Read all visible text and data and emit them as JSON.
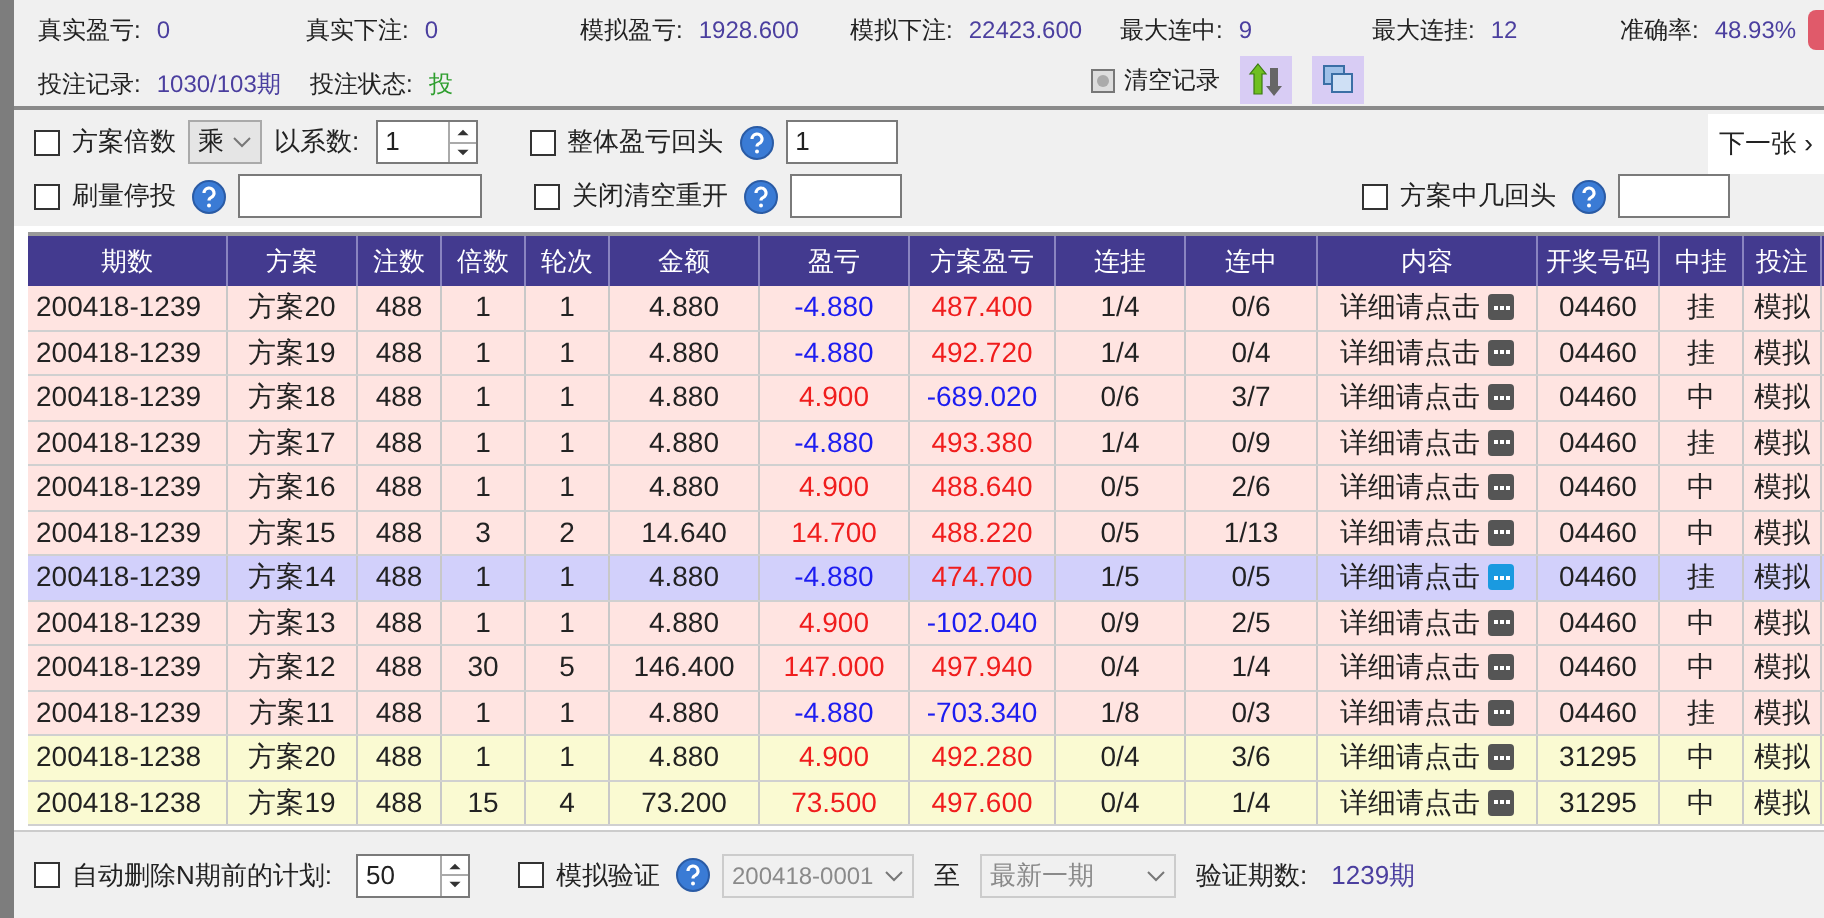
{
  "stats_row_1": [
    {
      "label": "真实盈亏:",
      "value": "0"
    },
    {
      "label": "真实下注:",
      "value": "0"
    },
    {
      "label": "模拟盈亏:",
      "value": "1928.600"
    },
    {
      "label": "模拟下注:",
      "value": "22423.600"
    },
    {
      "label": "最大连中:",
      "value": "9"
    },
    {
      "label": "最大连挂:",
      "value": "12"
    },
    {
      "label": "准确率:",
      "value": "48.93%"
    }
  ],
  "stats_row_2": [
    {
      "label": "投注记录:",
      "value": "1030/103期",
      "kind": "normal"
    },
    {
      "label": "投注状态:",
      "value": "投",
      "kind": "status"
    }
  ],
  "clear_button": "清空记录",
  "options": {
    "scheme_multiple": {
      "label": "方案倍数",
      "checked": false
    },
    "operator": "乘",
    "coefficient_label": "以系数:",
    "coefficient": "1",
    "overall_reset": {
      "label": "整体盈亏回头",
      "checked": false,
      "value": "1"
    },
    "volume_stop": {
      "label": "刷量停投",
      "checked": false
    },
    "close_clear": {
      "label": "关闭清空重开",
      "checked": false
    },
    "scheme_hit_reset": {
      "label": "方案中几回头",
      "checked": false
    },
    "next_button": "下一张 ›"
  },
  "table": {
    "columns": [
      "期数",
      "方案",
      "注数",
      "倍数",
      "轮次",
      "金额",
      "盈亏",
      "方案盈亏",
      "连挂",
      "连中",
      "内容",
      "开奖号码",
      "中挂",
      "投注"
    ],
    "rows": [
      {
        "selected": false,
        "color": "#ffe4e1",
        "period": "200418-1239",
        "scheme": "方案20",
        "count": "488",
        "multiple": "1",
        "round": "1",
        "amount": "4.880",
        "profit": "-4.880",
        "profit_negative": true,
        "scheme_profit": "487.400",
        "scheme_profit_negative": false,
        "miss_streak": "1/4",
        "hit_streak": "0/6",
        "content": "详细请点击",
        "draw": "04460",
        "result": "挂",
        "bet": "模拟"
      },
      {
        "selected": false,
        "color": "#ffe4e1",
        "period": "200418-1239",
        "scheme": "方案19",
        "count": "488",
        "multiple": "1",
        "round": "1",
        "amount": "4.880",
        "profit": "-4.880",
        "profit_negative": true,
        "scheme_profit": "492.720",
        "scheme_profit_negative": false,
        "miss_streak": "1/4",
        "hit_streak": "0/4",
        "content": "详细请点击",
        "draw": "04460",
        "result": "挂",
        "bet": "模拟"
      },
      {
        "selected": false,
        "color": "#ffe4e1",
        "period": "200418-1239",
        "scheme": "方案18",
        "count": "488",
        "multiple": "1",
        "round": "1",
        "amount": "4.880",
        "profit": "4.900",
        "profit_negative": false,
        "scheme_profit": "-689.020",
        "scheme_profit_negative": true,
        "miss_streak": "0/6",
        "hit_streak": "3/7",
        "content": "详细请点击",
        "draw": "04460",
        "result": "中",
        "bet": "模拟"
      },
      {
        "selected": false,
        "color": "#ffe4e1",
        "period": "200418-1239",
        "scheme": "方案17",
        "count": "488",
        "multiple": "1",
        "round": "1",
        "amount": "4.880",
        "profit": "-4.880",
        "profit_negative": true,
        "scheme_profit": "493.380",
        "scheme_profit_negative": false,
        "miss_streak": "1/4",
        "hit_streak": "0/9",
        "content": "详细请点击",
        "draw": "04460",
        "result": "挂",
        "bet": "模拟"
      },
      {
        "selected": false,
        "color": "#ffe4e1",
        "period": "200418-1239",
        "scheme": "方案16",
        "count": "488",
        "multiple": "1",
        "round": "1",
        "amount": "4.880",
        "profit": "4.900",
        "profit_negative": false,
        "scheme_profit": "488.640",
        "scheme_profit_negative": false,
        "miss_streak": "0/5",
        "hit_streak": "2/6",
        "content": "详细请点击",
        "draw": "04460",
        "result": "中",
        "bet": "模拟"
      },
      {
        "selected": false,
        "color": "#ffe4e1",
        "period": "200418-1239",
        "scheme": "方案15",
        "count": "488",
        "multiple": "3",
        "round": "2",
        "amount": "14.640",
        "profit": "14.700",
        "profit_negative": false,
        "scheme_profit": "488.220",
        "scheme_profit_negative": false,
        "miss_streak": "0/5",
        "hit_streak": "1/13",
        "content": "详细请点击",
        "draw": "04460",
        "result": "中",
        "bet": "模拟"
      },
      {
        "selected": true,
        "color": "#d2d0fb",
        "period": "200418-1239",
        "scheme": "方案14",
        "count": "488",
        "multiple": "1",
        "round": "1",
        "amount": "4.880",
        "profit": "-4.880",
        "profit_negative": true,
        "scheme_profit": "474.700",
        "scheme_profit_negative": false,
        "miss_streak": "1/5",
        "hit_streak": "0/5",
        "content": "详细请点击",
        "draw": "04460",
        "result": "挂",
        "bet": "模拟"
      },
      {
        "selected": false,
        "color": "#ffe4e1",
        "period": "200418-1239",
        "scheme": "方案13",
        "count": "488",
        "multiple": "1",
        "round": "1",
        "amount": "4.880",
        "profit": "4.900",
        "profit_negative": false,
        "scheme_profit": "-102.040",
        "scheme_profit_negative": true,
        "miss_streak": "0/9",
        "hit_streak": "2/5",
        "content": "详细请点击",
        "draw": "04460",
        "result": "中",
        "bet": "模拟"
      },
      {
        "selected": false,
        "color": "#ffe4e1",
        "period": "200418-1239",
        "scheme": "方案12",
        "count": "488",
        "multiple": "30",
        "round": "5",
        "amount": "146.400",
        "profit": "147.000",
        "profit_negative": false,
        "scheme_profit": "497.940",
        "scheme_profit_negative": false,
        "miss_streak": "0/4",
        "hit_streak": "1/4",
        "content": "详细请点击",
        "draw": "04460",
        "result": "中",
        "bet": "模拟"
      },
      {
        "selected": false,
        "color": "#ffe4e1",
        "period": "200418-1239",
        "scheme": "方案11",
        "count": "488",
        "multiple": "1",
        "round": "1",
        "amount": "4.880",
        "profit": "-4.880",
        "profit_negative": true,
        "scheme_profit": "-703.340",
        "scheme_profit_negative": true,
        "miss_streak": "1/8",
        "hit_streak": "0/3",
        "content": "详细请点击",
        "draw": "04460",
        "result": "挂",
        "bet": "模拟"
      },
      {
        "selected": false,
        "color": "#fafad2",
        "period": "200418-1238",
        "scheme": "方案20",
        "count": "488",
        "multiple": "1",
        "round": "1",
        "amount": "4.880",
        "profit": "4.900",
        "profit_negative": false,
        "scheme_profit": "492.280",
        "scheme_profit_negative": false,
        "miss_streak": "0/4",
        "hit_streak": "3/6",
        "content": "详细请点击",
        "draw": "31295",
        "result": "中",
        "bet": "模拟"
      },
      {
        "selected": false,
        "color": "#fafad2",
        "period": "200418-1238",
        "scheme": "方案19",
        "count": "488",
        "multiple": "15",
        "round": "4",
        "amount": "73.200",
        "profit": "73.500",
        "profit_negative": false,
        "scheme_profit": "497.600",
        "scheme_profit_negative": false,
        "miss_streak": "0/4",
        "hit_streak": "1/4",
        "content": "详细请点击",
        "draw": "31295",
        "result": "中",
        "bet": "模拟"
      }
    ]
  },
  "footer": {
    "auto_delete": {
      "label": "自动删除N期前的计划:",
      "checked": false,
      "value": "50"
    },
    "simulate": {
      "label": "模拟验证",
      "checked": false,
      "from": "200418-0001",
      "to_label": "至",
      "to": "最新一期"
    },
    "count_label": "验证期数:",
    "count_value": "1239期"
  }
}
